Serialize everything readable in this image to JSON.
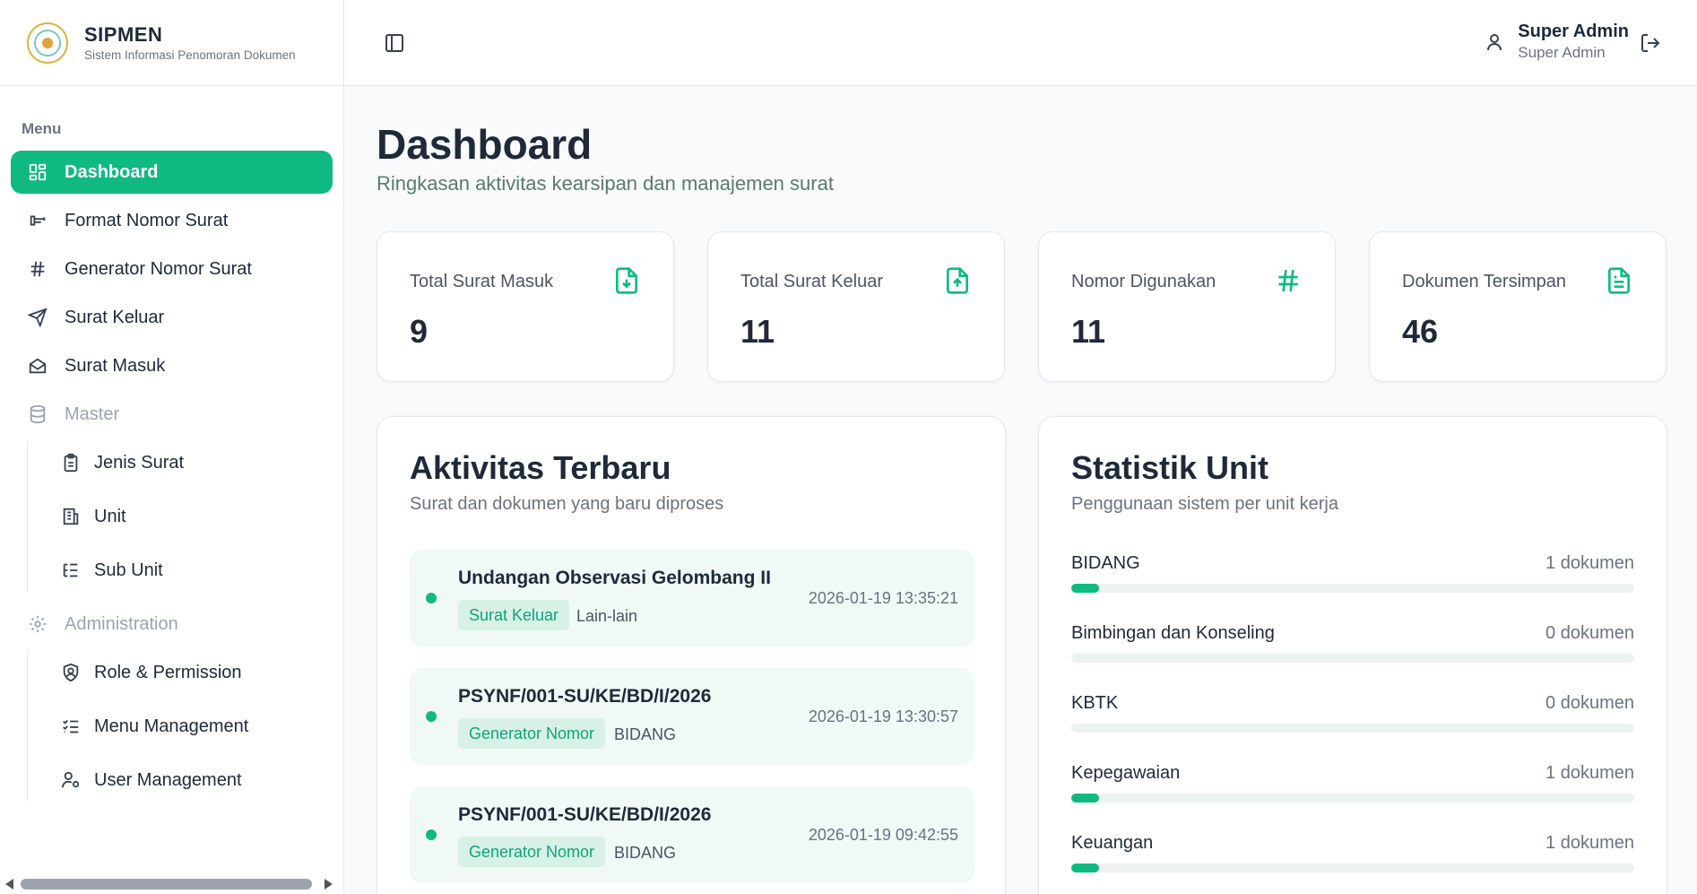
{
  "brand": {
    "title": "SIPMEN",
    "subtitle": "Sistem Informasi Penomoran Dokumen"
  },
  "sidebar": {
    "menu_label": "Menu",
    "items": [
      {
        "label": "Dashboard",
        "icon": "dashboard-icon",
        "active": true
      },
      {
        "label": "Format Nomor Surat",
        "icon": "format-icon"
      },
      {
        "label": "Generator Nomor Surat",
        "icon": "hash-icon"
      },
      {
        "label": "Surat Keluar",
        "icon": "send-icon"
      },
      {
        "label": "Surat Masuk",
        "icon": "inbox-icon"
      }
    ],
    "master": {
      "label": "Master",
      "icon": "database-icon",
      "items": [
        {
          "label": "Jenis Surat",
          "icon": "clipboard-icon"
        },
        {
          "label": "Unit",
          "icon": "building-icon"
        },
        {
          "label": "Sub Unit",
          "icon": "list-tree-icon"
        }
      ]
    },
    "administration": {
      "label": "Administration",
      "icon": "gear-icon",
      "items": [
        {
          "label": "Role & Permission",
          "icon": "shield-user-icon"
        },
        {
          "label": "Menu Management",
          "icon": "list-check-icon"
        },
        {
          "label": "User Management",
          "icon": "user-cog-icon"
        }
      ]
    }
  },
  "topbar": {
    "user_name": "Super Admin",
    "user_role": "Super Admin"
  },
  "page": {
    "title": "Dashboard",
    "subtitle": "Ringkasan aktivitas kearsipan dan manajemen surat"
  },
  "stats": [
    {
      "label": "Total Surat Masuk",
      "value": "9",
      "icon": "file-download-icon"
    },
    {
      "label": "Total Surat Keluar",
      "value": "11",
      "icon": "file-upload-icon"
    },
    {
      "label": "Nomor Digunakan",
      "value": "11",
      "icon": "hash-icon"
    },
    {
      "label": "Dokumen Tersimpan",
      "value": "46",
      "icon": "file-text-icon"
    }
  ],
  "activity": {
    "title": "Aktivitas Terbaru",
    "subtitle": "Surat dan dokumen yang baru diproses",
    "items": [
      {
        "title": "Undangan Observasi Gelombang II",
        "tag": "Surat Keluar",
        "category": "Lain-lain",
        "time": "2026-01-19 13:35:21"
      },
      {
        "title": "PSYNF/001-SU/KE/BD/I/2026",
        "tag": "Generator Nomor",
        "category": "BIDANG",
        "time": "2026-01-19 13:30:57"
      },
      {
        "title": "PSYNF/001-SU/KE/BD/I/2026",
        "tag": "Generator Nomor",
        "category": "BIDANG",
        "time": "2026-01-19 09:42:55"
      }
    ]
  },
  "units": {
    "title": "Statistik Unit",
    "subtitle": "Penggunaan sistem per unit kerja",
    "items": [
      {
        "name": "BIDANG",
        "count": "1 dokumen",
        "fraction": 0.05
      },
      {
        "name": "Bimbingan dan Konseling",
        "count": "0 dokumen",
        "fraction": 0
      },
      {
        "name": "KBTK",
        "count": "0 dokumen",
        "fraction": 0
      },
      {
        "name": "Kepegawaian",
        "count": "1 dokumen",
        "fraction": 0.05
      },
      {
        "name": "Keuangan",
        "count": "1 dokumen",
        "fraction": 0.05
      }
    ]
  },
  "colors": {
    "accent": "#10b981",
    "tag_bg": "#d7f1e6",
    "activity_bg": "#f0f9f5"
  }
}
